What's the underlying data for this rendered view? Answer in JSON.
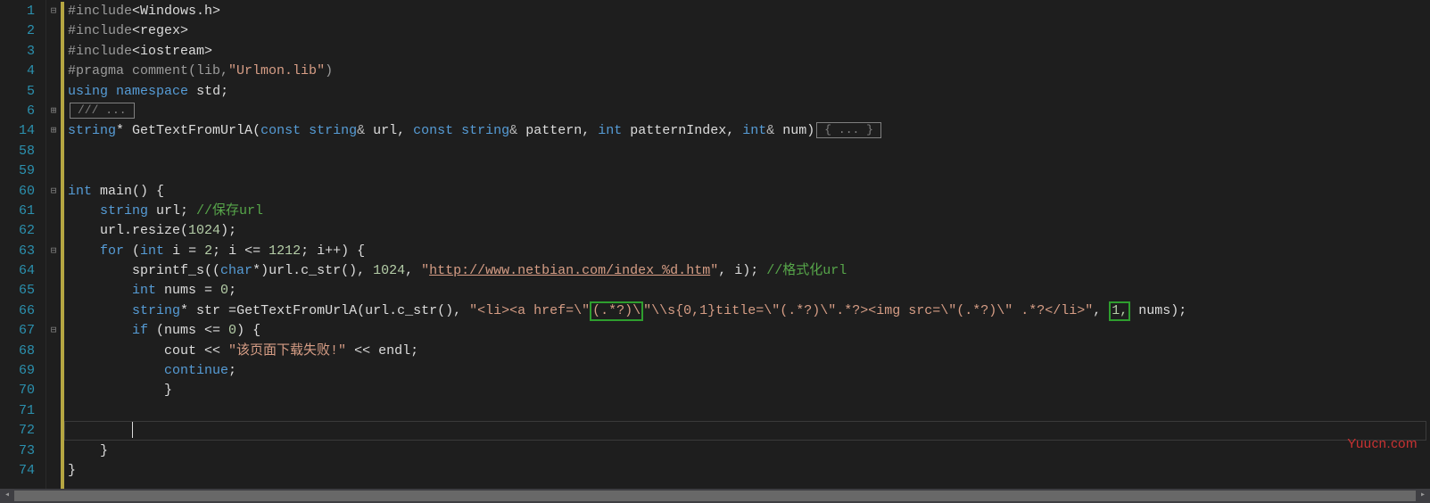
{
  "watermark": "Yuucn.com",
  "line_numbers": [
    "1",
    "2",
    "3",
    "4",
    "5",
    "6",
    "14",
    "58",
    "59",
    "60",
    "61",
    "62",
    "63",
    "64",
    "65",
    "66",
    "67",
    "68",
    "69",
    "70",
    "71",
    "72",
    "73",
    "74"
  ],
  "fold_markers": {
    "0": "minus",
    "5": "plus",
    "6": "plus",
    "9": "minus",
    "12": "minus",
    "16": "minus"
  },
  "code": {
    "l0": {
      "pp": "#include",
      "hdr": "<Windows.h>"
    },
    "l1": {
      "pp": "#include",
      "hdr": "<regex>"
    },
    "l2": {
      "pp": "#include",
      "hdr": "<iostream>"
    },
    "l3": {
      "pp": "#pragma",
      "rest": " comment(lib,",
      "str": "\"Urlmon.lib\"",
      "end": ")"
    },
    "l4": {
      "kw1": "using",
      "kw2": "namespace",
      "id": "std",
      "end": ";"
    },
    "l5": {
      "fold": "/// ..."
    },
    "l6": {
      "type": "string",
      "star": "* ",
      "fn": "GetTextFromUrlA",
      "p1": "(",
      "kw_c1": "const ",
      "t1": "string",
      "amp1": "& ",
      "a1": "url, ",
      "kw_c2": "const ",
      "t2": "string",
      "amp2": "& ",
      "a2": "pattern, ",
      "t3": "int ",
      "a3": "patternIndex, ",
      "t4": "int",
      "amp3": "& ",
      "a4": "num)",
      "fold": "{ ... }"
    },
    "l9": {
      "t": "int ",
      "fn": "main",
      "rest": "() {"
    },
    "l10": {
      "indent": "    ",
      "t": "string ",
      "id": "url; ",
      "cmt": "//保存url"
    },
    "l11": {
      "indent": "    ",
      "id": "url.resize(",
      "num": "1024",
      "end": ");"
    },
    "l12": {
      "indent": "    ",
      "kw": "for ",
      "p": "(",
      "t": "int ",
      "id": "i = ",
      "n1": "2",
      "mid": "; i <= ",
      "n2": "1212",
      "end": "; i++) {"
    },
    "l13": {
      "indent": "        ",
      "fn": "sprintf_s",
      "p": "((",
      "t": "char",
      "star": "*)url.c_str(), ",
      "n": "1024",
      "c": ", ",
      "str": "\"",
      "url": "http://www.netbian.com/index_%d.htm",
      "strend": "\"",
      "rest": ", i); ",
      "cmt": "//格式化url"
    },
    "l14": {
      "indent": "        ",
      "t": "int ",
      "id": "nums = ",
      "n": "0",
      "end": ";"
    },
    "l15": {
      "indent": "        ",
      "t": "string",
      "star": "* ",
      "id": "str =",
      "fn": "GetTextFromUrlA",
      "p": "(url.c_str(), ",
      "s1": "\"<li><a href=\\\"",
      "hl1": "(.*?)\\",
      "s2": "\"\\\\s{0,1}title=\\\"(.*?)\\\".*?><img src=\\\"(.*?)\\\" .*?</li>\"",
      "c": ", ",
      "hl2": "1,",
      "rest": " nums);"
    },
    "l16": {
      "indent": "        ",
      "kw": "if ",
      "rest": "(nums <= ",
      "n": "0",
      "end": ") {"
    },
    "l17": {
      "indent": "            ",
      "id": "cout << ",
      "str": "\"该页面下载失败!\"",
      "rest": " << endl;"
    },
    "l18": {
      "indent": "            ",
      "kw": "continue",
      "end": ";"
    },
    "l19": {
      "indent": "            ",
      "brace": "}"
    },
    "l21": {
      "indent": "        "
    },
    "l22": {
      "indent": "    ",
      "brace": "}"
    },
    "l23": {
      "brace": "}"
    }
  }
}
